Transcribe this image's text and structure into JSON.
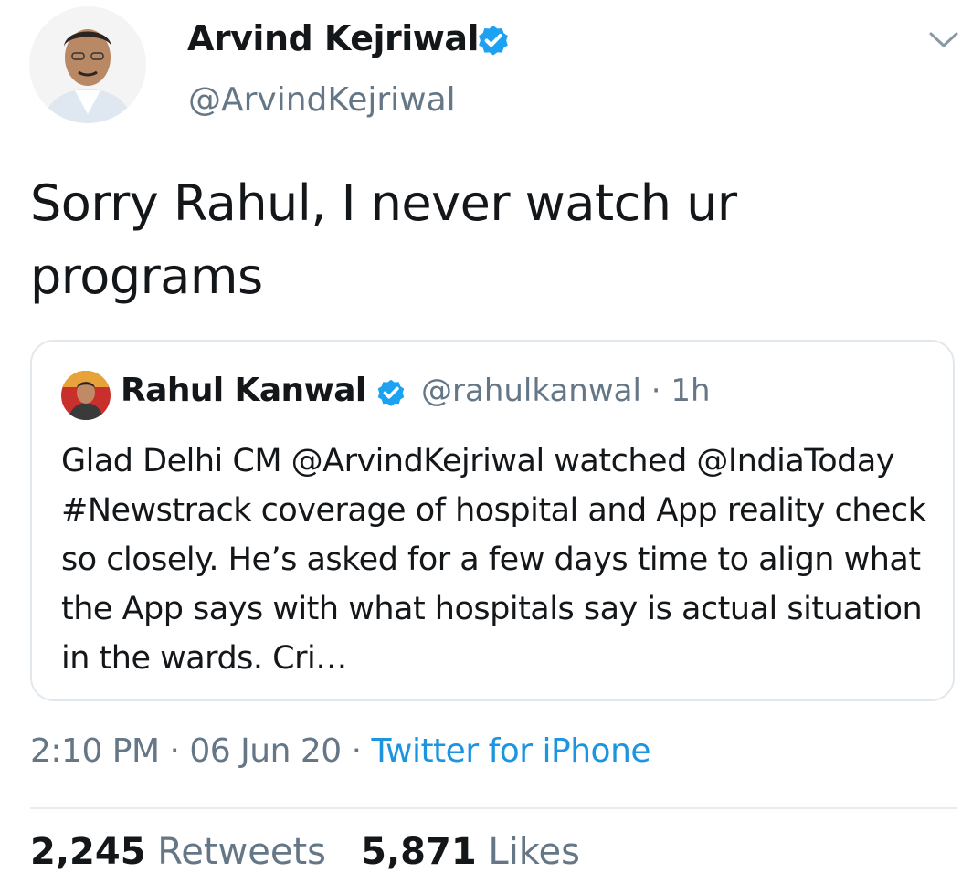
{
  "tweet": {
    "author": {
      "name": "Arvind Kejriwal",
      "handle": "@ArvindKejriwal",
      "verified": true
    },
    "text": "Sorry Rahul, I never watch ur programs",
    "quoted": {
      "name": "Rahul Kanwal",
      "verified": true,
      "meta": "@rahulkanwal · 1h",
      "text": "Glad Delhi CM @ArvindKejriwal watched @IndiaToday #Newstrack coverage of hospital and App reality check so closely. He’s asked for a few days time to align what the App says with what hospitals say is actual situation in the wards. Cri…"
    },
    "timestamp": "2:10 PM · 06 Jun 20 · ",
    "source": "Twitter for iPhone",
    "stats": {
      "retweets_count": "2,245",
      "retweets_label": "Retweets",
      "likes_count": "5,871",
      "likes_label": "Likes"
    }
  },
  "colors": {
    "verified": "#1da1f2",
    "link": "#1b95e0",
    "secondary_text": "#657786"
  },
  "icons": {
    "verified": "verified-badge-icon",
    "more": "chevron-down-icon"
  }
}
